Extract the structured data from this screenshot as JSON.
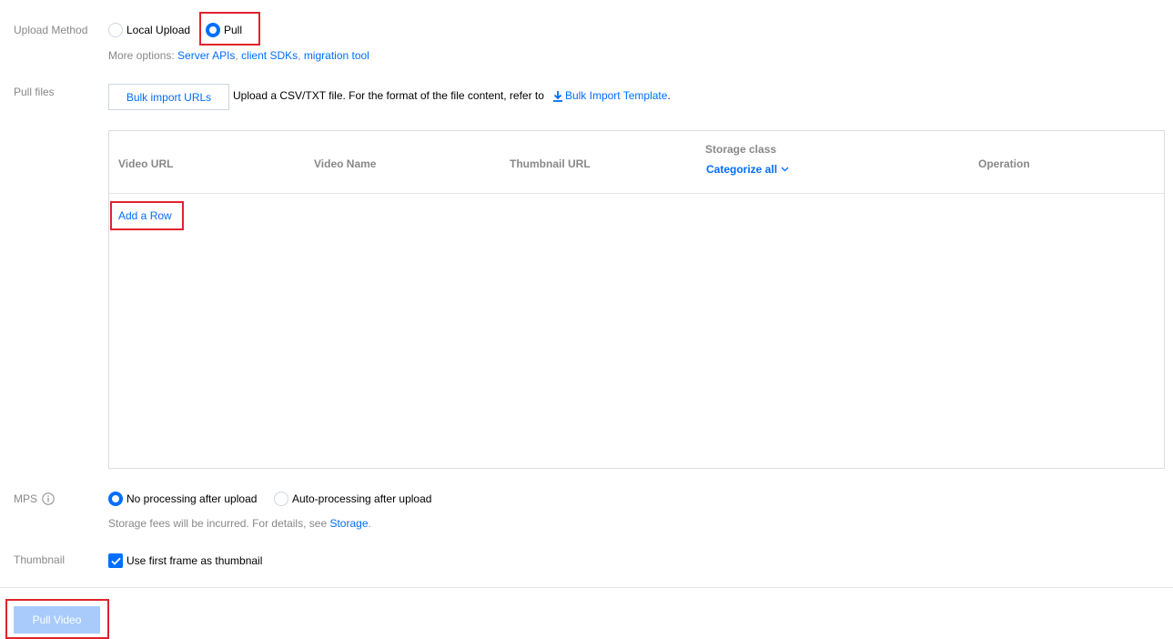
{
  "upload_method": {
    "label": "Upload Method",
    "options": [
      {
        "label": "Local Upload",
        "checked": false
      },
      {
        "label": "Pull",
        "checked": true
      }
    ],
    "more_options_prefix": "More options:",
    "more_links": [
      "Server APIs",
      "client SDKs",
      "migration tool"
    ]
  },
  "pull_files": {
    "label": "Pull files",
    "bulk_button": "Bulk import URLs",
    "description": "Upload a CSV/TXT file. For the format of the file content, refer to",
    "template_link": "Bulk Import Template",
    "template_suffix": "."
  },
  "table": {
    "columns": [
      "Video URL",
      "Video Name",
      "Thumbnail URL",
      "Storage class",
      "Operation"
    ],
    "storage_filter": "Categorize all",
    "add_row": "Add a Row"
  },
  "mps": {
    "label": "MPS",
    "options": [
      {
        "label": "No processing after upload",
        "checked": true
      },
      {
        "label": "Auto-processing after upload",
        "checked": false
      }
    ],
    "fee_text": "Storage fees will be incurred. For details, see",
    "fee_link": "Storage",
    "fee_suffix": "."
  },
  "thumbnail": {
    "label": "Thumbnail",
    "checkbox_label": "Use first frame as thumbnail",
    "checked": true
  },
  "footer": {
    "submit_label": "Pull Video"
  },
  "icons": {
    "info": "info-icon",
    "download": "download-icon",
    "chevron": "chevron-down-icon",
    "check": "check-icon"
  },
  "colors": {
    "accent": "#006eff",
    "highlight": "#e0232d",
    "muted": "#888888",
    "disabled_button": "#a8cbfb"
  }
}
